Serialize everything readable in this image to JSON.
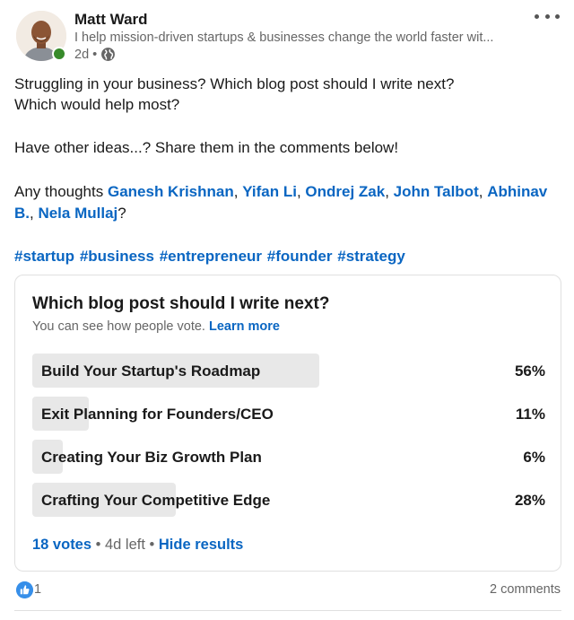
{
  "author": {
    "name": "Matt Ward",
    "headline": "I help mission-driven startups & businesses change the world faster wit...",
    "posted_ago": "2d",
    "separator": "•"
  },
  "post": {
    "line1": "Struggling in your business? Which blog post should I write next?",
    "line2": "Which would help most?",
    "line3": "Have other ideas...? Share them in the comments below!",
    "thoughts_prefix": "Any thoughts ",
    "mentions": [
      "Ganesh Krishnan",
      "Yifan Li",
      "Ondrej Zak",
      "John Talbot",
      "Abhinav",
      "B.",
      "Nela Mullaj"
    ],
    "comma": ", ",
    "question_mark": "?",
    "hashtags": [
      "#startup",
      "#business",
      "#entrepreneur",
      "#founder",
      "#strategy"
    ]
  },
  "poll": {
    "question": "Which blog post should I write next?",
    "note": "You can see how people vote. ",
    "learn_more": "Learn more",
    "options": [
      {
        "label": "Build Your Startup's Roadmap",
        "percent": "56%",
        "share": 0.56
      },
      {
        "label": "Exit Planning for Founders/CEO",
        "percent": "11%",
        "share": 0.11
      },
      {
        "label": "Creating Your Biz Growth Plan",
        "percent": "6%",
        "share": 0.06
      },
      {
        "label": "Crafting Your Competitive Edge",
        "percent": "28%",
        "share": 0.28
      }
    ],
    "votes": "18 votes",
    "time_left": " • 4d left • ",
    "hide_results": "Hide results"
  },
  "social": {
    "reaction_count": "1",
    "comments": "2 comments"
  },
  "colors": {
    "link": "#0a66c2",
    "online": "#378a2a",
    "like": "#378fe9",
    "poll_fill": "#e8e8e8"
  },
  "icons": [
    "more-options-icon",
    "online-status-icon",
    "globe-icon",
    "like-reaction-icon"
  ]
}
